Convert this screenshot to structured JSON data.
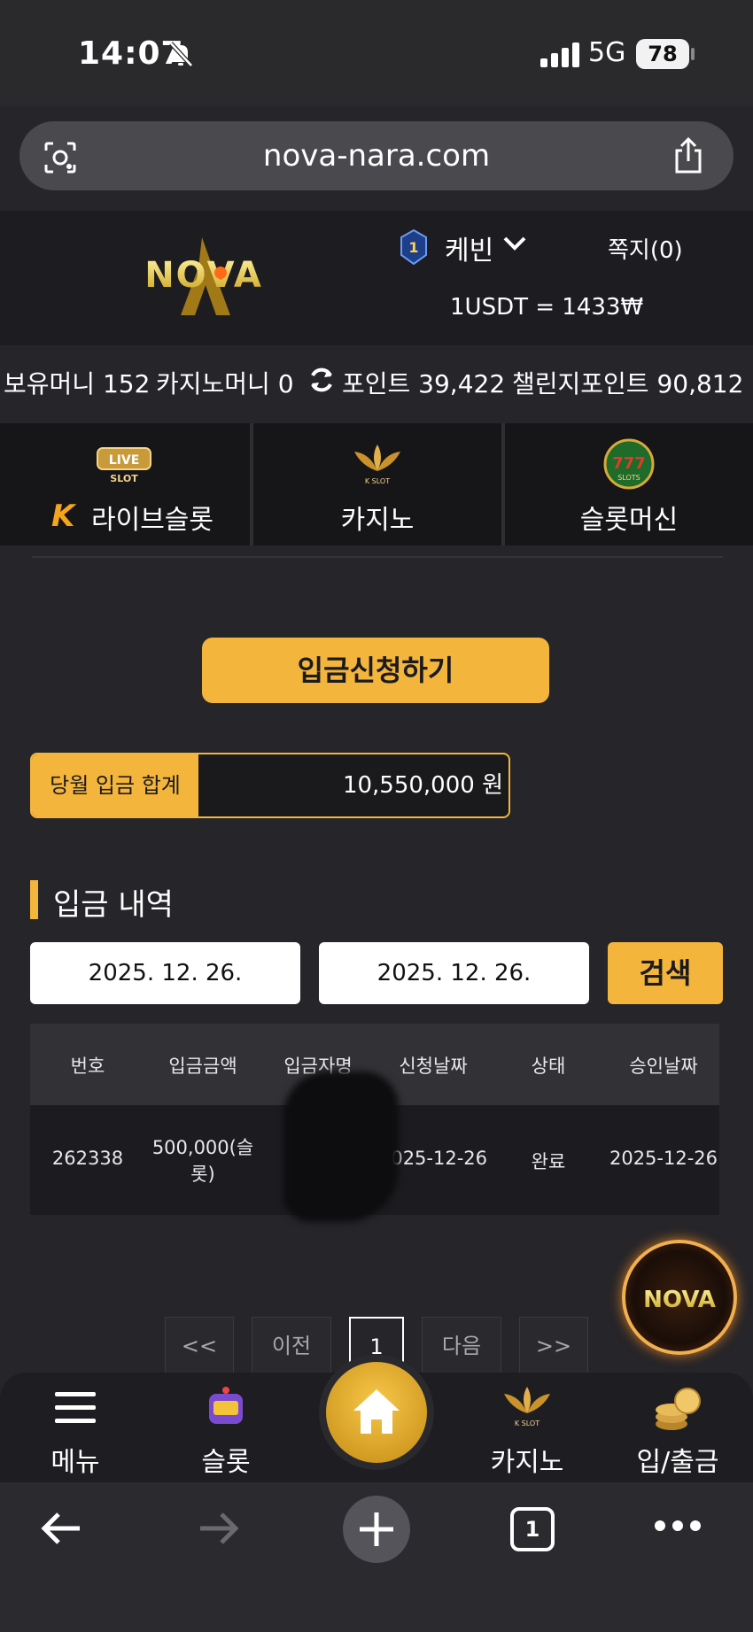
{
  "status_bar": {
    "time": "14:07",
    "network": "5G",
    "battery": "78"
  },
  "browser": {
    "url": "nova-nara.com",
    "tab_count": "1"
  },
  "header": {
    "logo": "NOVA",
    "level": "1",
    "username": "케빈",
    "messages": "쪽지(0)",
    "exchange_rate": "1USDT = 1433₩"
  },
  "balances": {
    "money": "보유머니 152",
    "casino_money": "카지노머니 0",
    "points": "포인트 39,422",
    "challenge_points": "챌린지포인트 90,812"
  },
  "game_tabs": [
    {
      "label": "라이브슬롯"
    },
    {
      "label": "카지노"
    },
    {
      "label": "슬롯머신"
    }
  ],
  "deposit_button": "입금신청하기",
  "monthly_total": {
    "label": "당월 입금 합계",
    "value": "10,550,000 원"
  },
  "history": {
    "title": "입금 내역",
    "date_from": "2025. 12. 26.",
    "date_to": "2025. 12. 26.",
    "search": "검색",
    "columns": [
      "번호",
      "입금금액",
      "입금자명",
      "신청날짜",
      "상태",
      "승인날짜"
    ],
    "rows": [
      {
        "no": "262338",
        "amount_1": "500,000(슬",
        "amount_2": "롯)",
        "name": "",
        "requested": "2025-12-26",
        "status": "완료",
        "approved": "2025-12-26"
      }
    ]
  },
  "pagination": {
    "first": "<<",
    "prev": "이전",
    "current": "1",
    "next": "다음",
    "last": ">>"
  },
  "bottom_nav": [
    {
      "label": "메뉴"
    },
    {
      "label": "슬롯"
    },
    {
      "label": "카지노"
    },
    {
      "label": "입/출금"
    }
  ],
  "colors": {
    "accent": "#f4b53c",
    "background": "#262529"
  }
}
